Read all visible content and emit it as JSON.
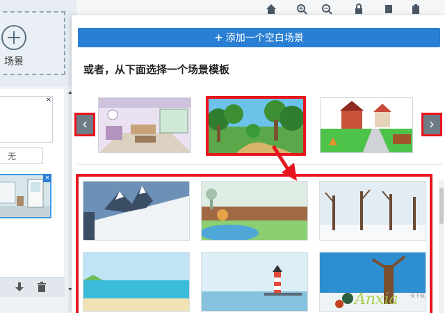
{
  "left_panel": {
    "add_scene_label": "场景",
    "none_badge": "无",
    "close_glyph": "×"
  },
  "toolbar": {
    "icons": [
      "home-icon",
      "zoom-in-icon",
      "zoom-out-icon",
      "lock-icon",
      "copy-icon",
      "paste-icon"
    ]
  },
  "dialog": {
    "add_blank_label": "添加一个空白场景",
    "or_heading": "或者，从下面选择一个场景模板",
    "prev_glyph": "‹",
    "next_glyph": "›"
  },
  "watermark": {
    "text": "Anxia",
    "sub": "安下载"
  },
  "colors": {
    "primary": "#2a7fd4",
    "highlight_red": "#e8141e",
    "arrow_gray": "#6f7b85",
    "watermark": "#a7c93a"
  }
}
